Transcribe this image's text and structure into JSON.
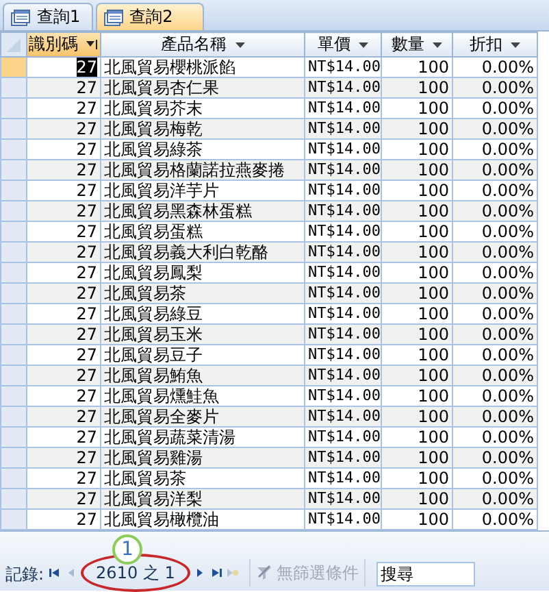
{
  "tabs": [
    {
      "label": "查詢1",
      "selected": false
    },
    {
      "label": "查詢2",
      "selected": true
    }
  ],
  "table": {
    "columns": [
      {
        "label": "識別碼",
        "filtered": true
      },
      {
        "label": "產品名稱",
        "filtered": false
      },
      {
        "label": "單價",
        "filtered": false
      },
      {
        "label": "數量",
        "filtered": false
      },
      {
        "label": "折扣",
        "filtered": false
      }
    ],
    "rows": [
      {
        "selected": true,
        "cells": [
          "27",
          "北風貿易櫻桃派餡",
          "NT$14.00",
          "100",
          "0.00%"
        ]
      },
      {
        "selected": false,
        "cells": [
          "27",
          "北風貿易杏仁果",
          "NT$14.00",
          "100",
          "0.00%"
        ]
      },
      {
        "selected": false,
        "cells": [
          "27",
          "北風貿易芥末",
          "NT$14.00",
          "100",
          "0.00%"
        ]
      },
      {
        "selected": false,
        "cells": [
          "27",
          "北風貿易梅乾",
          "NT$14.00",
          "100",
          "0.00%"
        ]
      },
      {
        "selected": false,
        "cells": [
          "27",
          "北風貿易綠茶",
          "NT$14.00",
          "100",
          "0.00%"
        ]
      },
      {
        "selected": false,
        "cells": [
          "27",
          "北風貿易格蘭諾拉燕麥捲",
          "NT$14.00",
          "100",
          "0.00%"
        ]
      },
      {
        "selected": false,
        "cells": [
          "27",
          "北風貿易洋芋片",
          "NT$14.00",
          "100",
          "0.00%"
        ]
      },
      {
        "selected": false,
        "cells": [
          "27",
          "北風貿易黑森林蛋糕",
          "NT$14.00",
          "100",
          "0.00%"
        ]
      },
      {
        "selected": false,
        "cells": [
          "27",
          "北風貿易蛋糕",
          "NT$14.00",
          "100",
          "0.00%"
        ]
      },
      {
        "selected": false,
        "cells": [
          "27",
          "北風貿易義大利白乾酪",
          "NT$14.00",
          "100",
          "0.00%"
        ]
      },
      {
        "selected": false,
        "cells": [
          "27",
          "北風貿易鳳梨",
          "NT$14.00",
          "100",
          "0.00%"
        ]
      },
      {
        "selected": false,
        "cells": [
          "27",
          "北風貿易茶",
          "NT$14.00",
          "100",
          "0.00%"
        ]
      },
      {
        "selected": false,
        "cells": [
          "27",
          "北風貿易綠豆",
          "NT$14.00",
          "100",
          "0.00%"
        ]
      },
      {
        "selected": false,
        "cells": [
          "27",
          "北風貿易玉米",
          "NT$14.00",
          "100",
          "0.00%"
        ]
      },
      {
        "selected": false,
        "cells": [
          "27",
          "北風貿易豆子",
          "NT$14.00",
          "100",
          "0.00%"
        ]
      },
      {
        "selected": false,
        "cells": [
          "27",
          "北風貿易鮪魚",
          "NT$14.00",
          "100",
          "0.00%"
        ]
      },
      {
        "selected": false,
        "cells": [
          "27",
          "北風貿易燻鮭魚",
          "NT$14.00",
          "100",
          "0.00%"
        ]
      },
      {
        "selected": false,
        "cells": [
          "27",
          "北風貿易全麥片",
          "NT$14.00",
          "100",
          "0.00%"
        ]
      },
      {
        "selected": false,
        "cells": [
          "27",
          "北風貿易蔬菜清湯",
          "NT$14.00",
          "100",
          "0.00%"
        ]
      },
      {
        "selected": false,
        "cells": [
          "27",
          "北風貿易雞湯",
          "NT$14.00",
          "100",
          "0.00%"
        ]
      },
      {
        "selected": false,
        "cells": [
          "27",
          "北風貿易茶",
          "NT$14.00",
          "100",
          "0.00%"
        ]
      },
      {
        "selected": false,
        "cells": [
          "27",
          "北風貿易洋梨",
          "NT$14.00",
          "100",
          "0.00%"
        ]
      },
      {
        "selected": false,
        "cells": [
          "27",
          "北風貿易橄欖油",
          "NT$14.00",
          "100",
          "0.00%"
        ]
      }
    ]
  },
  "navigator": {
    "label": "記錄:",
    "position": "2610 之 1",
    "filter": "無篩選條件",
    "search_placeholder": "搜尋"
  },
  "callout": {
    "number": "1"
  }
}
